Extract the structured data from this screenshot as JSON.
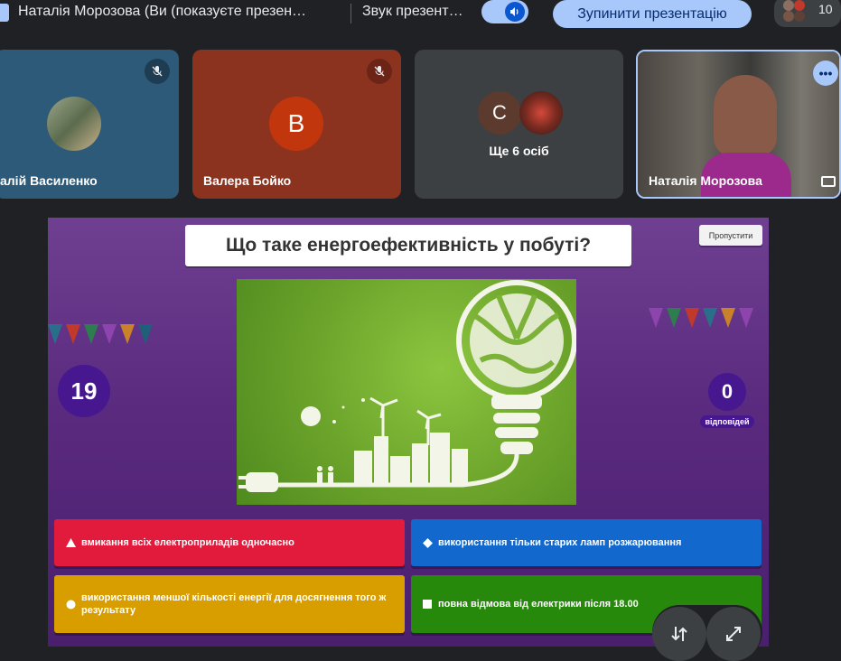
{
  "topbar": {
    "title": "Наталія Морозова (Ви (показуєте презен…",
    "sound_label": "Звук презент…",
    "stop_button": "Зупинити презентацію",
    "people_count": "10",
    "accent": "#a8c7fa"
  },
  "participants": [
    {
      "name": "алій Василенко",
      "muted": true,
      "color": "#2d5a78"
    },
    {
      "name": "Валера Бойко",
      "muted": true,
      "color": "#8c3320",
      "initial": "B"
    },
    {
      "name": "Ще 6 осіб",
      "initial": "C",
      "color": "#3c4043"
    },
    {
      "name": "Наталія Морозова",
      "color": "#2b2b2b"
    }
  ],
  "quiz": {
    "question": "Що таке енергоефективність у побуті?",
    "skip_button": "Пропустити",
    "timer": "19",
    "answers_count": "0",
    "answers_label": "відповідей",
    "answers": [
      {
        "text": "вмикання всіх електроприладів одночасно",
        "shape": "triangle-icon",
        "color": "#e21b3c"
      },
      {
        "text": "використання тільки старих ламп розжарювання",
        "shape": "diamond-icon",
        "color": "#1368ce"
      },
      {
        "text": "використання меншої кількості енергії для досягнення того ж результату",
        "shape": "circle-icon",
        "color": "#d89e00"
      },
      {
        "text": "повна відмова від електрики після 18.00",
        "shape": "square-icon",
        "color": "#26890c"
      }
    ]
  },
  "controls": [
    "swap-icon",
    "fullscreen-icon"
  ]
}
